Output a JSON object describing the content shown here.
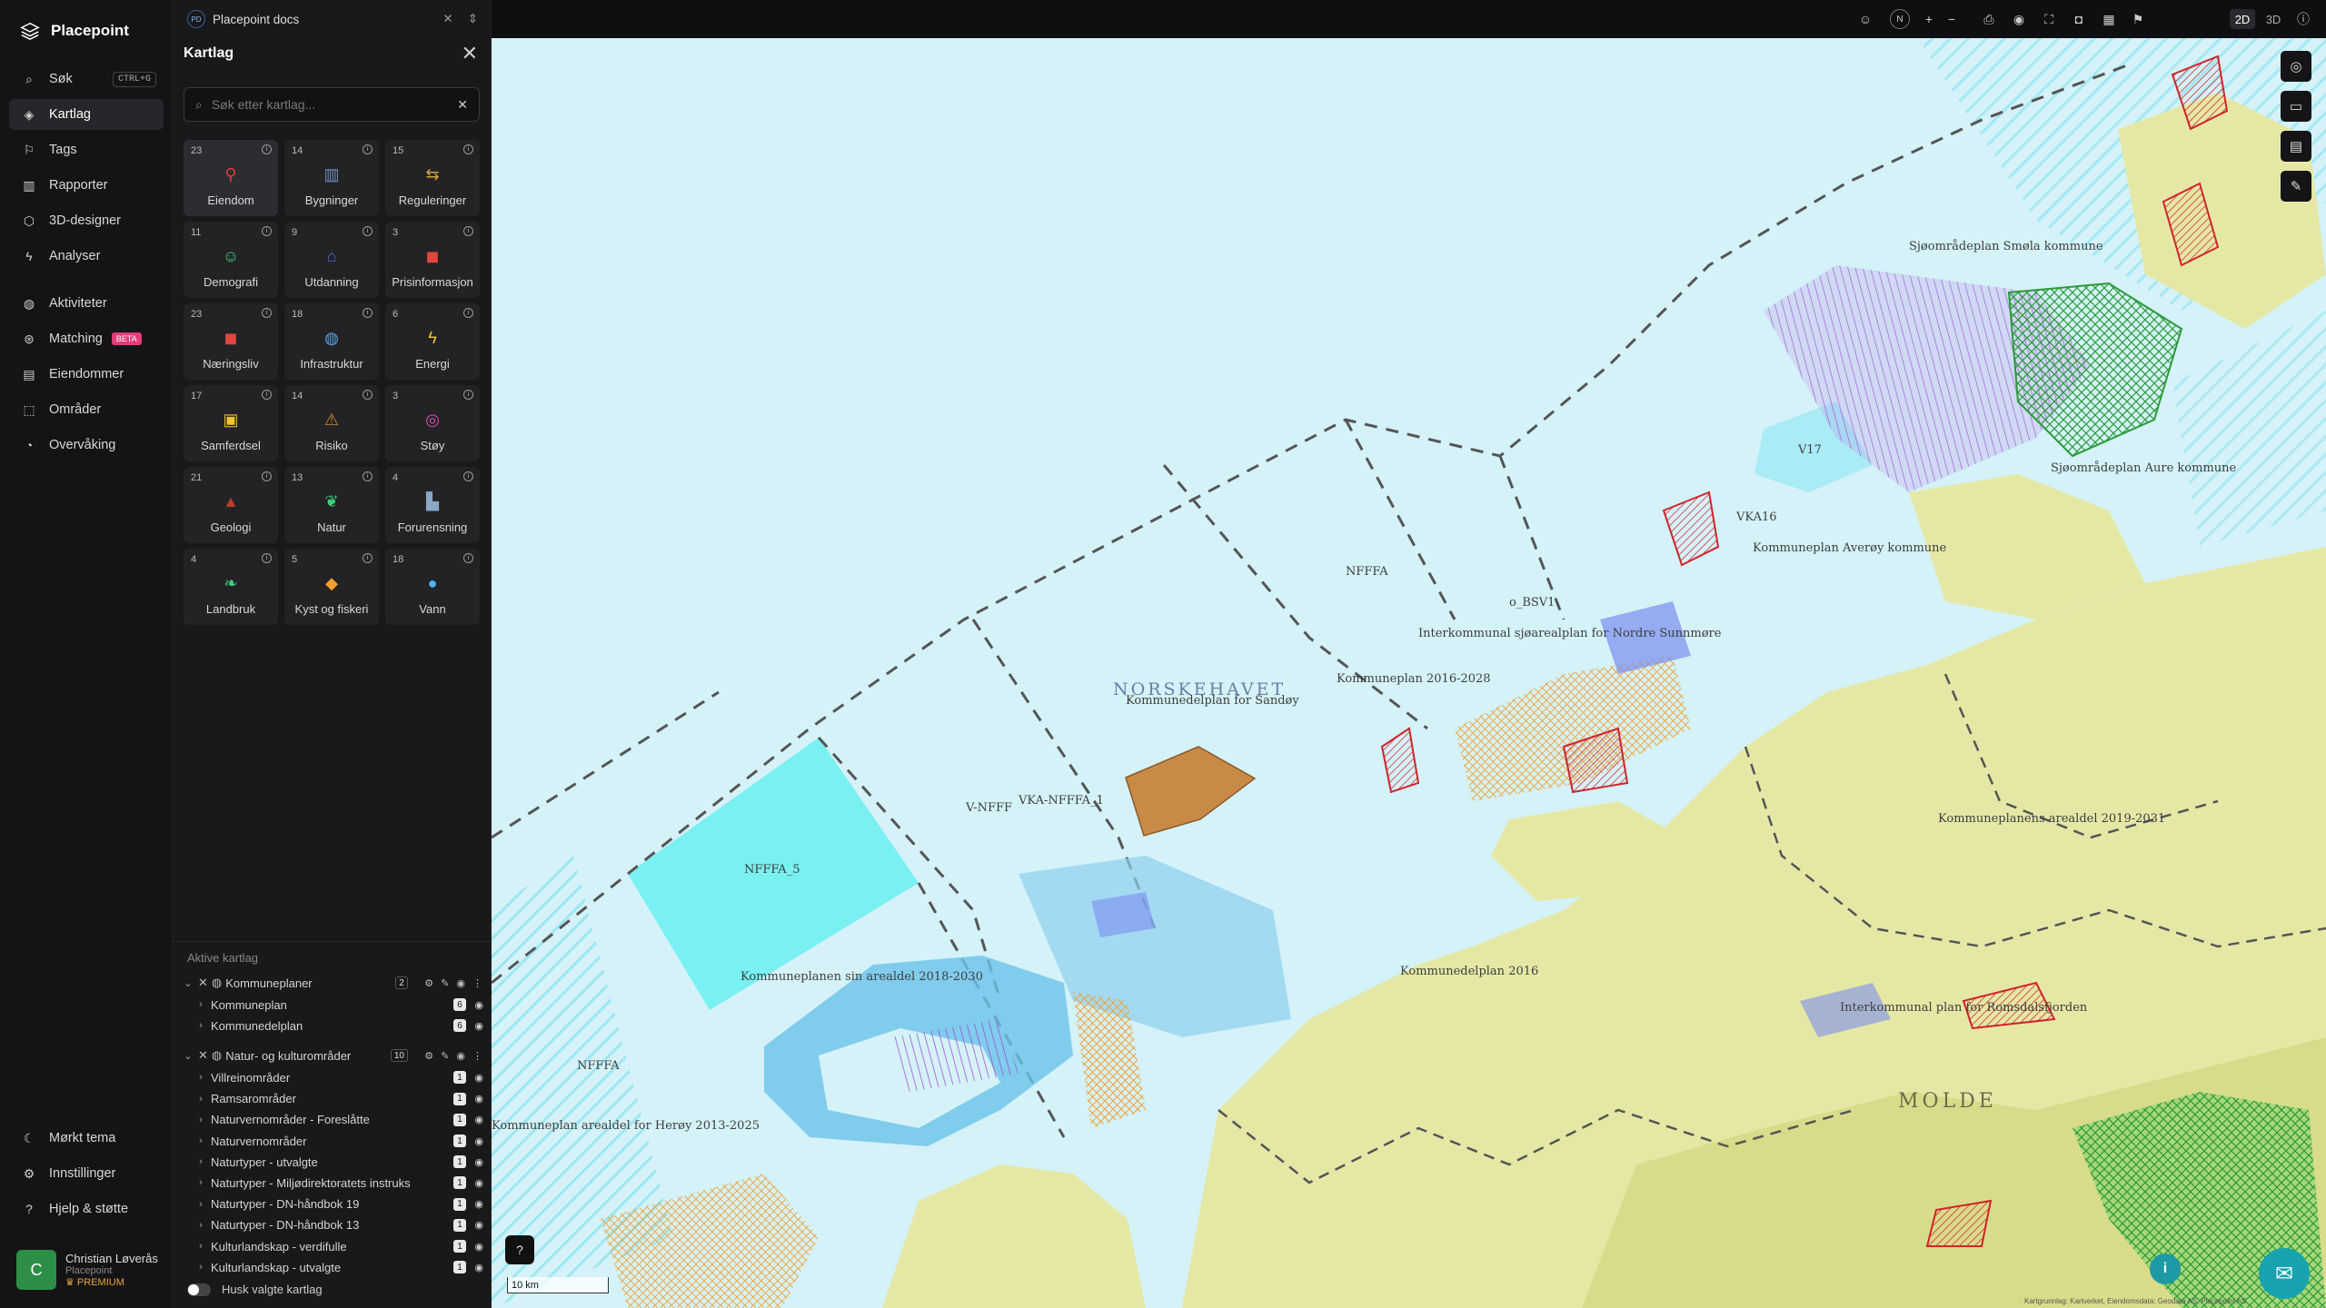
{
  "app": {
    "name": "Placepoint"
  },
  "nav": {
    "items": [
      {
        "label": "Søk",
        "icon": "search-icon",
        "shortcut": "CTRL+G"
      },
      {
        "label": "Kartlag",
        "icon": "layers-icon"
      },
      {
        "label": "Tags",
        "icon": "bookmark-icon"
      },
      {
        "label": "Rapporter",
        "icon": "chart-icon"
      },
      {
        "label": "3D-designer",
        "icon": "cube-icon"
      },
      {
        "label": "Analyser",
        "icon": "bolt-icon"
      },
      {
        "label": "Aktiviteter",
        "icon": "activity-icon"
      },
      {
        "label": "Matching",
        "icon": "match-icon",
        "badge": "BETA"
      },
      {
        "label": "Eiendommer",
        "icon": "property-icon"
      },
      {
        "label": "Områder",
        "icon": "area-icon"
      },
      {
        "label": "Overvåking",
        "icon": "monitor-icon"
      }
    ],
    "bottom": [
      {
        "label": "Mørkt tema",
        "icon": "moon-icon"
      },
      {
        "label": "Innstillinger",
        "icon": "gear-icon"
      },
      {
        "label": "Hjelp & støtte",
        "icon": "help-icon"
      }
    ],
    "user": {
      "initial": "C",
      "name": "Christian Løverås",
      "org": "Placepoint",
      "plan": "PREMIUM"
    }
  },
  "panel": {
    "project": {
      "badge": "PD",
      "name": "Placepoint docs"
    },
    "title": "Kartlag",
    "search_placeholder": "Søk etter kartlag...",
    "tiles": [
      {
        "count": "23",
        "label": "Eiendom",
        "icon": "pin-icon",
        "color": "#e23b3b"
      },
      {
        "count": "14",
        "label": "Bygninger",
        "icon": "building-icon",
        "color": "#6f8fbf"
      },
      {
        "count": "15",
        "label": "Reguleringer",
        "icon": "signpost-icon",
        "color": "#d9a441"
      },
      {
        "count": "11",
        "label": "Demografi",
        "icon": "people-icon",
        "color": "#3ecf7a"
      },
      {
        "count": "9",
        "label": "Utdanning",
        "icon": "graduation-icon",
        "color": "#4a6cd9"
      },
      {
        "count": "3",
        "label": "Prisinformasjon",
        "icon": "bag-icon",
        "color": "#e2463b"
      },
      {
        "count": "23",
        "label": "Næringsliv",
        "icon": "shop-icon",
        "color": "#e2463b"
      },
      {
        "count": "18",
        "label": "Infrastruktur",
        "icon": "globe-icon",
        "color": "#5aa2e8"
      },
      {
        "count": "6",
        "label": "Energi",
        "icon": "lightning-icon",
        "color": "#f2c230"
      },
      {
        "count": "17",
        "label": "Samferdsel",
        "icon": "bus-icon",
        "color": "#f2c230"
      },
      {
        "count": "14",
        "label": "Risiko",
        "icon": "warning-icon",
        "color": "#c98a3a"
      },
      {
        "count": "3",
        "label": "Støy",
        "icon": "noise-icon",
        "color": "#e24bb0"
      },
      {
        "count": "21",
        "label": "Geologi",
        "icon": "terrain-icon",
        "color": "#c0392b"
      },
      {
        "count": "13",
        "label": "Natur",
        "icon": "leaf-icon",
        "color": "#3ecf7a"
      },
      {
        "count": "4",
        "label": "Forurensning",
        "icon": "factory-icon",
        "color": "#8aa8c8"
      },
      {
        "count": "4",
        "label": "Landbruk",
        "icon": "sprout-icon",
        "color": "#3ecf7a"
      },
      {
        "count": "5",
        "label": "Kyst og fiskeri",
        "icon": "fish-icon",
        "color": "#f2a030"
      },
      {
        "count": "18",
        "label": "Vann",
        "icon": "drop-icon",
        "color": "#4fb3f0"
      }
    ],
    "active_title": "Aktive kartlag",
    "groups": [
      {
        "name": "Kommuneplaner",
        "count": "2",
        "layers": [
          {
            "name": "Kommuneplan",
            "count": "6"
          },
          {
            "name": "Kommunedelplan",
            "count": "6"
          }
        ]
      },
      {
        "name": "Natur- og kulturområder",
        "count": "10",
        "layers": [
          {
            "name": "Villreinområder",
            "count": "1"
          },
          {
            "name": "Ramsarområder",
            "count": "1"
          },
          {
            "name": "Naturvernområder - Foreslåtte",
            "count": "1"
          },
          {
            "name": "Naturvernområder",
            "count": "1"
          },
          {
            "name": "Naturtyper - utvalgte",
            "count": "1"
          },
          {
            "name": "Naturtyper - Miljødirektoratets instruks",
            "count": "1"
          },
          {
            "name": "Naturtyper - DN-håndbok 19",
            "count": "1"
          },
          {
            "name": "Naturtyper - DN-håndbok 13",
            "count": "1"
          },
          {
            "name": "Kulturlandskap - verdifulle",
            "count": "1"
          },
          {
            "name": "Kulturlandskap - utvalgte",
            "count": "1"
          }
        ]
      }
    ],
    "remember_label": "Husk valgte kartlag"
  },
  "topbar": {
    "view_2d": "2D",
    "view_3d": "3D",
    "compass": "N"
  },
  "map": {
    "labels": {
      "sea": "NORSKEHAVET",
      "kdp_sandoy": "Kommunedelplan for Sandøy",
      "nfffa5": "NFFFA_5",
      "nfffa_a": "NFFFA",
      "nfffa_b": "NFFFA",
      "vnfff": "V-NFFF",
      "vka_nfffa": "VKA-NFFFA_1",
      "kp_sin": "Kommuneplanen sin arealdel 2018-2030",
      "kp_2016": "Kommuneplan 2016-2028",
      "herøy": "Kommuneplan arealdel for Herøy 2013-2025",
      "interkom": "Interkommunal sjøarealplan for Nordre Sunnmøre",
      "interkom2": "Interkommunal plan for Romsdalsfjorden",
      "smola": "Sjøområdeplan Smøla kommune",
      "aure": "Sjøområdeplan Aure kommune",
      "averoy": "Kommuneplan Averøy kommune",
      "v17": "V17",
      "vka16": "VKA16",
      "obsv": "o_BSV1",
      "romsdal": "Kommuneplanens arealdel 2019-2031",
      "giske": "Kommunedelplan 2016",
      "moldegrend": "MOLDE"
    },
    "scale_label": "10 km",
    "attribution": "Kartgrunnlag: Kartverket, Eiendomsdata: Geodata AS, Placepoint AS"
  },
  "colors": {
    "accent": "#18a3ae",
    "land": "#e5e8a5",
    "sea": "#d4f2f8",
    "danger": "#d0232a",
    "beta": "#e23c7b"
  }
}
